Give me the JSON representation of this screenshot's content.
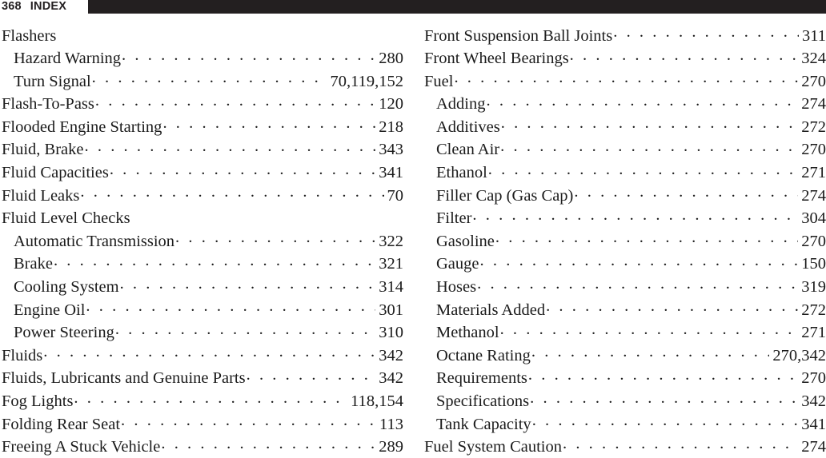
{
  "header": {
    "folio": "368",
    "title": "INDEX",
    "bar_color": "#231f20"
  },
  "columns": [
    {
      "name": "left-column",
      "entries": [
        {
          "label": "Flashers",
          "level": 1,
          "page": ""
        },
        {
          "label": "Hazard Warning",
          "level": 2,
          "page": "280"
        },
        {
          "label": "Turn Signal",
          "level": 2,
          "page": "70,119,152"
        },
        {
          "label": "Flash-To-Pass",
          "level": 1,
          "page": "120"
        },
        {
          "label": "Flooded Engine Starting",
          "level": 1,
          "page": "218"
        },
        {
          "label": "Fluid, Brake",
          "level": 1,
          "page": "343"
        },
        {
          "label": "Fluid Capacities",
          "level": 1,
          "page": "341"
        },
        {
          "label": "Fluid Leaks",
          "level": 1,
          "page": "70"
        },
        {
          "label": "Fluid Level Checks",
          "level": 1,
          "page": ""
        },
        {
          "label": "Automatic Transmission",
          "level": 2,
          "page": "322"
        },
        {
          "label": "Brake",
          "level": 2,
          "page": "321"
        },
        {
          "label": "Cooling System",
          "level": 2,
          "page": "314"
        },
        {
          "label": "Engine Oil",
          "level": 2,
          "page": "301"
        },
        {
          "label": "Power Steering",
          "level": 2,
          "page": "310"
        },
        {
          "label": "Fluids",
          "level": 1,
          "page": "342"
        },
        {
          "label": "Fluids, Lubricants and Genuine Parts",
          "level": 1,
          "page": "342"
        },
        {
          "label": "Fog Lights",
          "level": 1,
          "page": "118,154"
        },
        {
          "label": "Folding Rear Seat",
          "level": 1,
          "page": "113"
        },
        {
          "label": "Freeing A Stuck Vehicle",
          "level": 1,
          "page": "289"
        }
      ]
    },
    {
      "name": "right-column",
      "entries": [
        {
          "label": "Front Suspension Ball Joints",
          "level": 1,
          "page": "311"
        },
        {
          "label": "Front Wheel Bearings",
          "level": 1,
          "page": "324"
        },
        {
          "label": "Fuel",
          "level": 1,
          "page": "270"
        },
        {
          "label": "Adding",
          "level": 2,
          "page": "274"
        },
        {
          "label": "Additives",
          "level": 2,
          "page": "272"
        },
        {
          "label": "Clean Air",
          "level": 2,
          "page": "270"
        },
        {
          "label": "Ethanol",
          "level": 2,
          "page": "271"
        },
        {
          "label": "Filler Cap (Gas Cap)",
          "level": 2,
          "page": "274"
        },
        {
          "label": "Filter",
          "level": 2,
          "page": "304"
        },
        {
          "label": "Gasoline",
          "level": 2,
          "page": "270"
        },
        {
          "label": "Gauge",
          "level": 2,
          "page": "150"
        },
        {
          "label": "Hoses",
          "level": 2,
          "page": "319"
        },
        {
          "label": "Materials Added",
          "level": 2,
          "page": "272"
        },
        {
          "label": "Methanol",
          "level": 2,
          "page": "271"
        },
        {
          "label": "Octane Rating",
          "level": 2,
          "page": "270,342"
        },
        {
          "label": "Requirements",
          "level": 2,
          "page": "270"
        },
        {
          "label": "Specifications",
          "level": 2,
          "page": "342"
        },
        {
          "label": "Tank Capacity",
          "level": 2,
          "page": "341"
        },
        {
          "label": "Fuel System Caution",
          "level": 1,
          "page": "274"
        }
      ]
    }
  ]
}
